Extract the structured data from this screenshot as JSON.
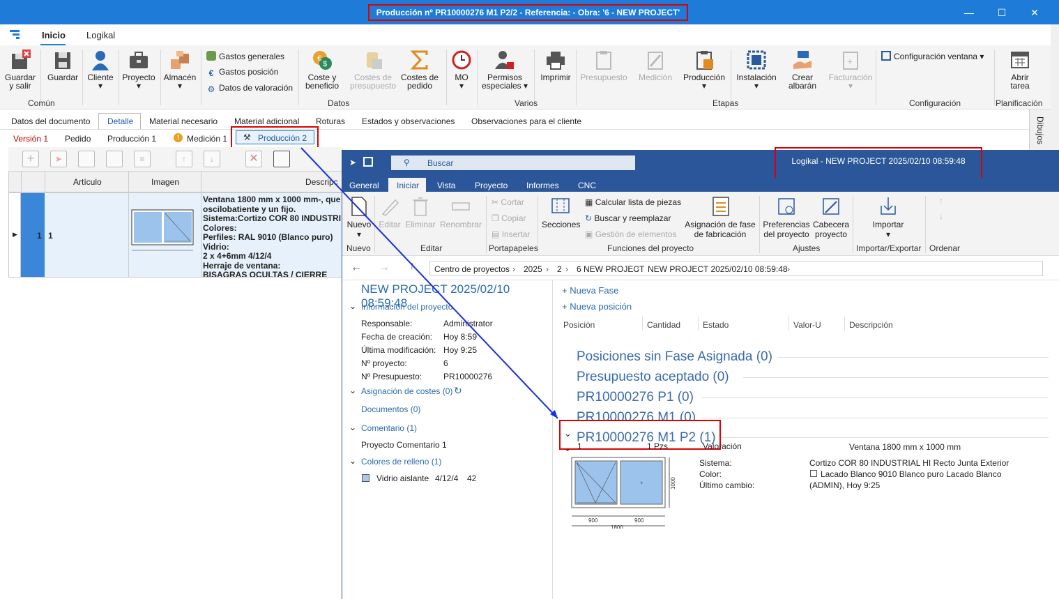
{
  "window": {
    "title": "Producción nº PR10000276 M1 P2/2 - Referencia:  - Obra: '6 - NEW PROJECT'"
  },
  "ribbon_tabs": [
    "Inicio",
    "Logikal"
  ],
  "ribbon": {
    "buttons": {
      "guardar_salir": "Guardar y salir",
      "guardar": "Guardar",
      "cliente": "Cliente",
      "proyecto": "Proyecto",
      "almacen": "Almacén",
      "coste": "Coste y beneficio",
      "costes_pedido": "Costes de presupuesto",
      "costes_de_pedido": "Costes de pedido",
      "mo": "MO",
      "permisos": "Permisos especiales",
      "imprimir": "Imprimir",
      "presupuesto": "Presupuesto",
      "medicion": "Medición",
      "produccion": "Producción",
      "instalacion": "Instalación",
      "crear_albaran": "Crear albarán",
      "facturacion": "Facturación",
      "abrir_tarea": "Abrir tarea"
    },
    "small": {
      "gastos_generales": "Gastos generales",
      "gastos_posicion": "Gastos posición",
      "datos_valoracion": "Datos de valoración",
      "config_ventana": "Configuración ventana"
    },
    "groups": {
      "comun": "Común",
      "datos": "Datos",
      "varios": "Varios",
      "etapas": "Etapas",
      "configuracion": "Configuración",
      "planificacion": "Planificación"
    }
  },
  "doc_tabs": [
    "Datos del documento",
    "Detalle",
    "Material necesario",
    "Material adicional",
    "Roturas",
    "Estados y observaciones",
    "Observaciones para el cliente"
  ],
  "side_tab": "Dibujos",
  "sub_tabs": [
    "Versión 1",
    "Pedido",
    "Producción 1",
    "Medición 1",
    "Producción 2"
  ],
  "grid": {
    "headers": [
      "Artículo",
      "Imagen",
      "Descripc"
    ],
    "row": {
      "num": "1",
      "articulo": "1",
      "desc_lines": [
        "Ventana 1800 mm x 1000 mm-, que",
        "oscilobatiente y un fijo.",
        "Sistema:Cortizo COR 80 INDUSTRI",
        "Colores:",
        "Perfiles: RAL 9010 (Blanco puro)",
        "Vidrio:",
        "2 x 4+6mm 4/12/4",
        "Herraje de ventana:",
        "BISAGRAS OCULTAS / CIERRE"
      ]
    }
  },
  "logikal": {
    "search_placeholder": "Buscar",
    "title": "Logikal - NEW PROJECT 2025/02/10 08:59:48",
    "tabs": [
      "General",
      "Iniciar",
      "Vista",
      "Proyecto",
      "Informes",
      "CNC"
    ],
    "ribbon": {
      "nuevo": "Nuevo",
      "editar": "Editar",
      "eliminar": "Eliminar",
      "renombrar": "Renombrar",
      "cortar": "Cortar",
      "copiar": "Copiar",
      "insertar": "Insertar",
      "secciones": "Secciones",
      "calcular": "Calcular lista de piezas",
      "buscar_reemplazar": "Buscar y reemplazar",
      "gestion": "Gestión de elementos",
      "asignacion_fase": "Asignación de fase de fabricación",
      "preferencias": "Preferencias del proyecto",
      "cabecera": "Cabecera proyecto",
      "importar": "Importar",
      "groups": {
        "nuevo": "Nuevo",
        "editar": "Editar",
        "portapapeles": "Portapapeles",
        "funciones": "Funciones del proyecto",
        "ajustes": "Ajustes",
        "impexp": "Importar/Exportar",
        "ordenar": "Ordenar"
      }
    },
    "breadcrumb": [
      "Centro de proyectos",
      "2025",
      "2",
      "6 NEW PROJECT",
      "NEW PROJECT 2025/02/10 08:59:48"
    ],
    "left": {
      "project_title": "NEW PROJECT 2025/02/10 08:59:48",
      "info_header": "Información del proyecto",
      "fields": [
        {
          "label": "Responsable:",
          "value": "Administrator"
        },
        {
          "label": "Fecha de creación:",
          "value": "Hoy 8:59"
        },
        {
          "label": "Última modificación:",
          "value": "Hoy 9:25"
        },
        {
          "label": "Nº proyecto:",
          "value": "6"
        },
        {
          "label": "Nº Presupuesto:",
          "value": "PR10000276"
        }
      ],
      "asignacion": "Asignación de costes (0)",
      "documentos": "Documentos (0)",
      "comentario_header": "Comentario (1)",
      "comentario": "Proyecto Comentario 1",
      "colores_header": "Colores de relleno (1)",
      "color_name": "Vidrio aislante",
      "color_spec": "4/12/4",
      "color_num": "42"
    },
    "right": {
      "nueva_fase": "Nueva Fase",
      "nueva_posicion": "Nueva posición",
      "columns": [
        "Posición",
        "Cantidad",
        "Estado",
        "Valor-U",
        "Descripción"
      ],
      "phases": [
        "Posiciones sin Fase Asignada (0)",
        "Presupuesto aceptado (0)",
        "PR10000276 P1 (0)",
        "PR10000276 M1 (0)",
        "PR10000276 M1 P2 (1)"
      ],
      "item": {
        "pos": "1",
        "qty": "1 Pzs",
        "estado": "Valoración",
        "desc": "Ventana 1800 mm x 1000 mm",
        "sistema_label": "Sistema:",
        "sistema": "Cortizo COR 80 INDUSTRIAL HI Recto Junta Exterior",
        "color_label": "Color:",
        "color": "Lacado Blanco 9010 Blanco puro Lacado Blanco",
        "cambio_label": "Último cambio:",
        "cambio": "(ADMIN), Hoy 9:25",
        "dims": {
          "w1": "900",
          "w2": "900",
          "total": "1800",
          "h": "1000"
        }
      }
    }
  },
  "colors": {
    "accent": "#1e7bd8",
    "logikal": "#2b579a",
    "highlight": "#e00000",
    "link": "#2b6cb0"
  }
}
